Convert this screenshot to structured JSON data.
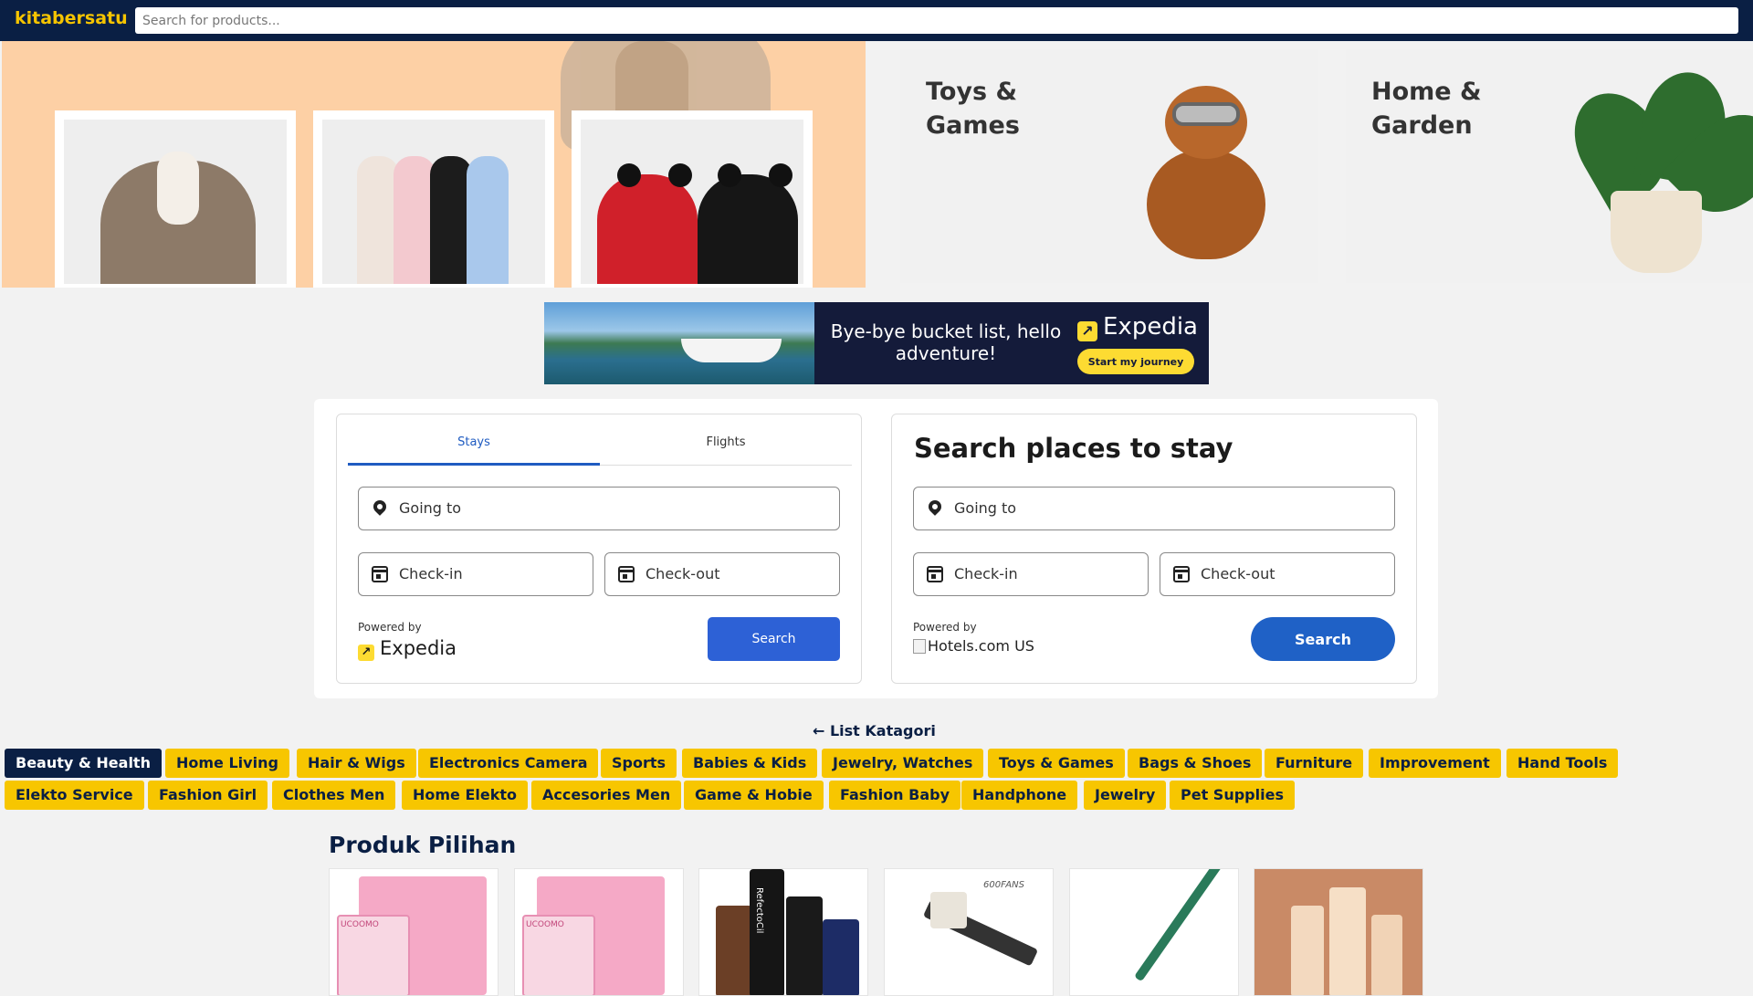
{
  "header": {
    "logo": "kitabersatu",
    "search_placeholder": "Search for products..."
  },
  "promos": {
    "toys": {
      "title": "Toys & Games"
    },
    "home": {
      "title": "Home & Garden"
    }
  },
  "banner": {
    "headline": "Bye-bye bucket list, hello adventure!",
    "brand": "Expedia",
    "cta": "Start my journey"
  },
  "expedia_widget": {
    "tabs": [
      {
        "label": "Stays",
        "active": true
      },
      {
        "label": "Flights",
        "active": false
      }
    ],
    "going_to": "Going to",
    "check_in": "Check-in",
    "check_out": "Check-out",
    "powered_by": "Powered by",
    "brand": "Expedia",
    "search_label": "Search"
  },
  "hotels_widget": {
    "title": "Search places to stay",
    "going_to": "Going to",
    "check_in": "Check-in",
    "check_out": "Check-out",
    "powered_by": "Powered by",
    "brand": "Hotels.com US",
    "search_label": "Search"
  },
  "categories": {
    "link": "← List Katagori",
    "active": "Beauty & Health",
    "items": [
      "Beauty & Health",
      "Home Living",
      "Hair & Wigs",
      "Electronics Camera",
      "Sports",
      "Babies & Kids",
      "Jewelry, Watches",
      "Toys & Games",
      "Bags & Shoes",
      "Furniture",
      "Improvement",
      "Hand Tools",
      "Elekto Service",
      "Fashion Girl",
      "Clothes Men",
      "Home Elekto",
      "Accesories Men",
      "Game & Hobie",
      "Fashion Baby",
      "Handphone",
      "Jewelry",
      "Pet Supplies"
    ]
  },
  "products": {
    "title": "Produk Pilihan",
    "items": [
      {
        "name": "lash-kit-1",
        "text": "UCOOMO"
      },
      {
        "name": "lash-kit-2",
        "text": "UCOOMO"
      },
      {
        "name": "tint-dye",
        "text": "RefectoCil"
      },
      {
        "name": "lash-brush",
        "text": "600FANS"
      },
      {
        "name": "tweezer",
        "text": ""
      },
      {
        "name": "foundation",
        "text": ""
      }
    ]
  },
  "colors": {
    "header_bg": "#0a1f44",
    "accent_yellow": "#f7c600",
    "expedia_blue": "#2d61d6",
    "hotels_blue": "#1f61c6"
  }
}
